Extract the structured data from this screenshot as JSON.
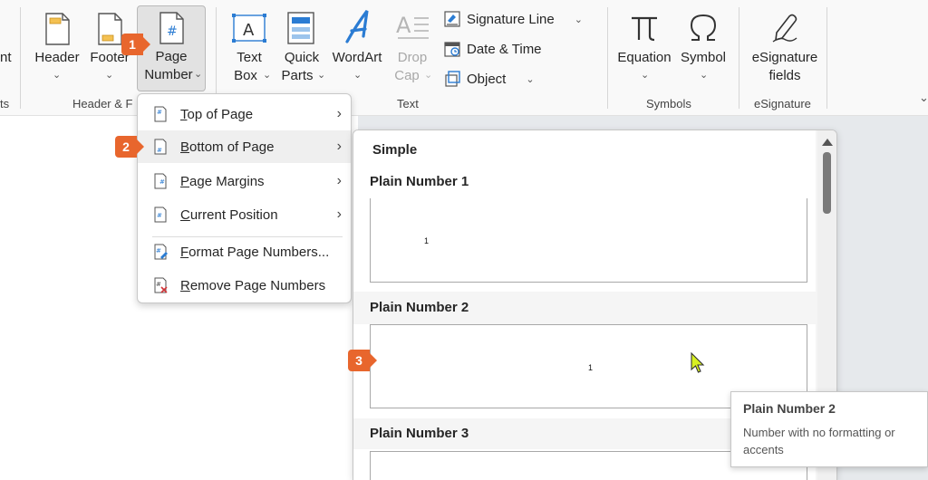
{
  "ribbon": {
    "left_partial_button": "nt",
    "left_partial_group": "ts",
    "groups": {
      "header_footer": "Header & F",
      "text": "Text",
      "symbols": "Symbols",
      "esignature": "eSignature"
    },
    "buttons": {
      "header": "Header",
      "footer": "Footer",
      "page_number_line1": "Page",
      "page_number_line2": "Number",
      "text_box_line1": "Text",
      "text_box_line2": "Box",
      "quick_parts_line1": "Quick",
      "quick_parts_line2": "Parts",
      "wordart": "WordArt",
      "drop_cap_line1": "Drop",
      "drop_cap_line2": "Cap",
      "signature_line": "Signature Line",
      "date_time": "Date & Time",
      "object": "Object",
      "equation": "Equation",
      "symbol": "Symbol",
      "esig_line1": "eSignature",
      "esig_line2": "fields"
    }
  },
  "badges": [
    "1",
    "2",
    "3"
  ],
  "menu": {
    "items": [
      {
        "label": "Top of Page",
        "accel": "T",
        "rest": "op of Page",
        "submenu": true
      },
      {
        "label": "Bottom of Page",
        "accel": "B",
        "rest": "ottom of Page",
        "submenu": true
      },
      {
        "label": "Page Margins",
        "accel": "P",
        "rest": "age Margins",
        "submenu": true
      },
      {
        "label": "Current Position",
        "accel": "C",
        "rest": "urrent Position",
        "submenu": true
      },
      {
        "label": "Format Page Numbers...",
        "accel": "F",
        "rest": "ormat Page Numbers...",
        "submenu": false
      },
      {
        "label": "Remove Page Numbers",
        "accel": "R",
        "rest": "emove Page Numbers",
        "submenu": false
      }
    ]
  },
  "gallery": {
    "section": "Simple",
    "items": [
      {
        "title": "Plain Number 1",
        "sample": "1"
      },
      {
        "title": "Plain Number 2",
        "sample": "1"
      },
      {
        "title": "Plain Number 3",
        "sample": ""
      }
    ]
  },
  "tooltip": {
    "title": "Plain Number 2",
    "description": "Number with no formatting or accents"
  },
  "colors": {
    "accent_blue": "#2b7cd3",
    "badge_orange": "#e8662d",
    "cursor_yellow": "#d8f022"
  }
}
